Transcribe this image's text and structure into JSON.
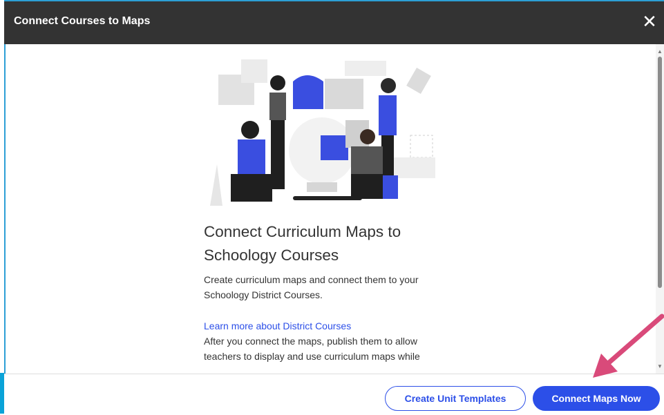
{
  "modal": {
    "title": "Connect Courses to Maps",
    "close_icon": "close-icon",
    "close_glyph": "✕"
  },
  "content": {
    "heading": "Connect Curriculum Maps to Schoology Courses",
    "paragraph1": "Create curriculum maps and connect them to your Schoology District Courses.",
    "link_text": "Learn more about District Courses",
    "paragraph2": "After you connect the maps, publish them to allow teachers to display and use curriculum maps while"
  },
  "footer": {
    "secondary_button": "Create Unit Templates",
    "primary_button": "Connect Maps Now"
  },
  "colors": {
    "header_bg": "#333333",
    "accent_blue": "#2c4fe8",
    "annotation_arrow": "#d94a7a"
  }
}
